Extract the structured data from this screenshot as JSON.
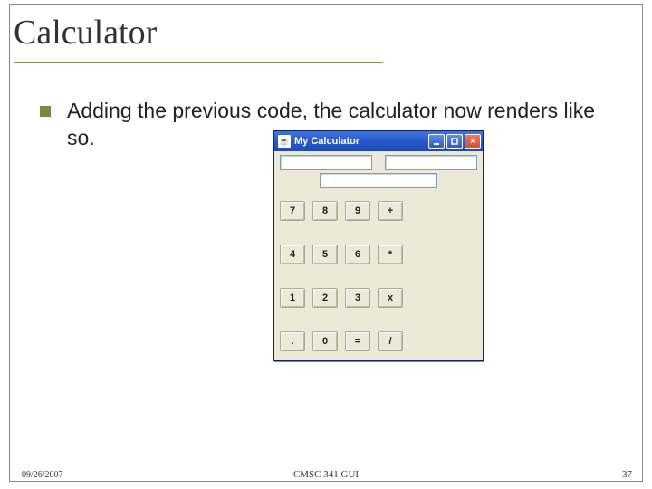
{
  "slide": {
    "title": "Calculator",
    "bullet": "Adding the previous code, the calculator now renders like so."
  },
  "calculator": {
    "window_title": "My Calculator",
    "rows": [
      [
        "7",
        "8",
        "9",
        "+"
      ],
      [
        "4",
        "5",
        "6",
        "*"
      ],
      [
        "1",
        "2",
        "3",
        "x"
      ],
      [
        ".",
        "0",
        "=",
        "/"
      ]
    ]
  },
  "footer": {
    "date": "09/26/2007",
    "center": "CMSC 341 GUI",
    "page": "37"
  }
}
